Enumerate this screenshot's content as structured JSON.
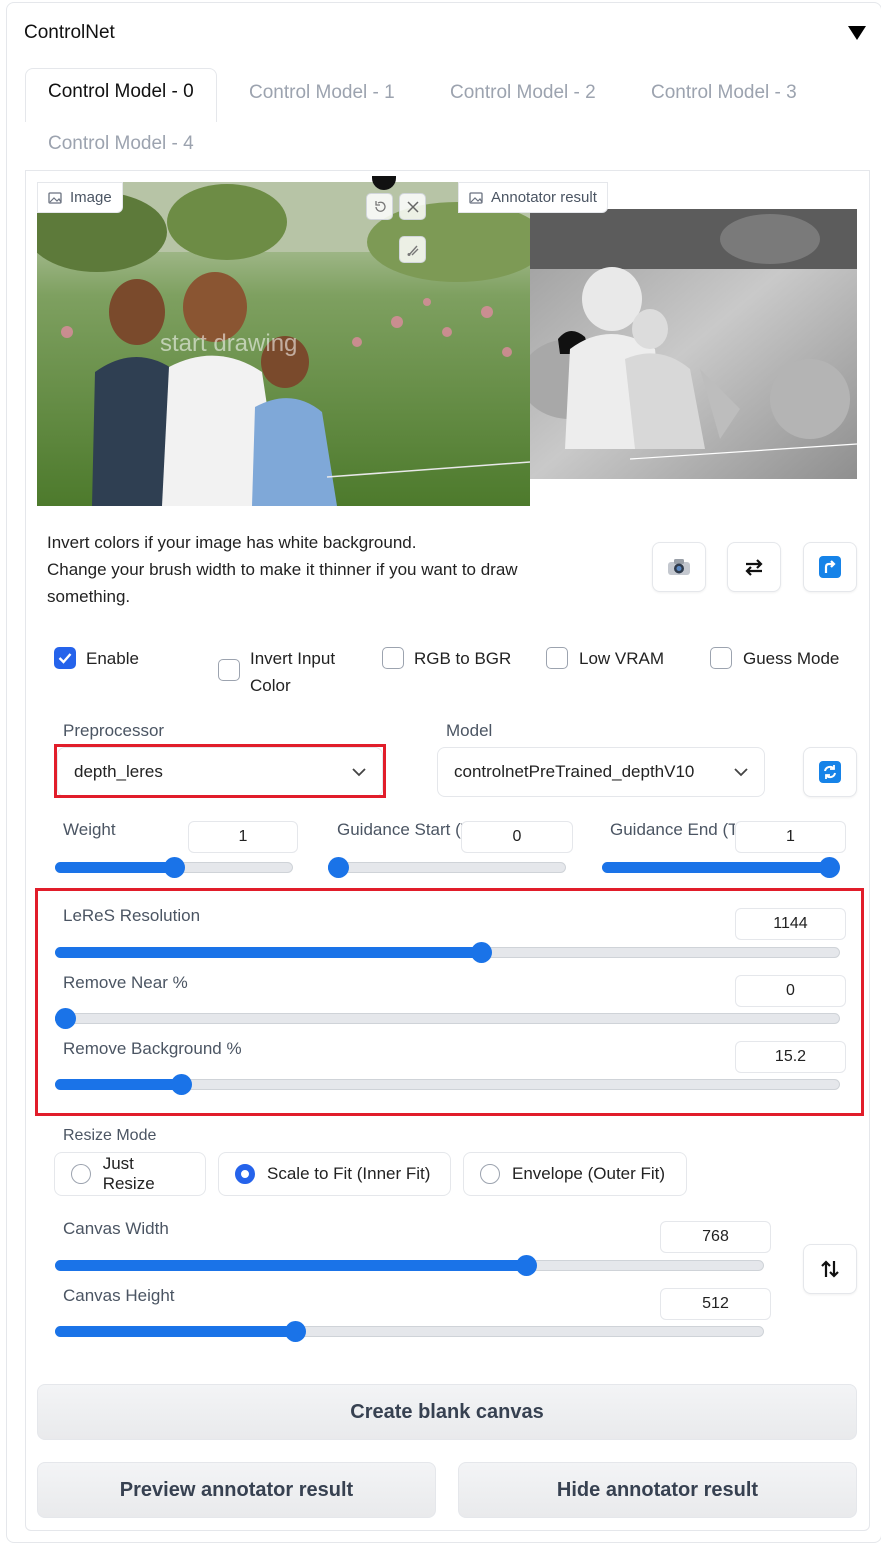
{
  "section": {
    "title": "ControlNet"
  },
  "tabs": [
    "Control Model - 0",
    "Control Model - 1",
    "Control Model - 2",
    "Control Model - 3",
    "Control Model - 4"
  ],
  "image_panel": {
    "label": "Image",
    "overlay_text": "start drawing",
    "icons": [
      "image-icon",
      "undo-icon",
      "close-icon",
      "brush-icon"
    ]
  },
  "annotator_panel": {
    "label": "Annotator result"
  },
  "info_text": [
    "Invert colors if your image has white background.",
    "Change your brush width to make it thinner if you want to draw something."
  ],
  "checkboxes": [
    {
      "label": "Enable",
      "checked": true
    },
    {
      "label": "Invert Input Color",
      "checked": false
    },
    {
      "label": "RGB to BGR",
      "checked": false
    },
    {
      "label": "Low VRAM",
      "checked": false
    },
    {
      "label": "Guess Mode",
      "checked": false
    }
  ],
  "preprocessor": {
    "label": "Preprocessor",
    "value": "depth_leres"
  },
  "model": {
    "label": "Model",
    "value": "controlnetPreTrained_depthV10"
  },
  "weight": {
    "label": "Weight",
    "value": "1",
    "fraction": 0.5
  },
  "guidance_start": {
    "label": "Guidance Start (T",
    "value": "0",
    "fraction": 0.0
  },
  "guidance_end": {
    "label": "Guidance End (T",
    "value": "1",
    "fraction": 1.0
  },
  "leres_resolution": {
    "label": "LeReS Resolution",
    "value": "1144",
    "fraction": 0.545
  },
  "remove_near": {
    "label": "Remove Near %",
    "value": "0",
    "fraction": 0.0
  },
  "remove_background": {
    "label": "Remove Background %",
    "value": "15.2",
    "fraction": 0.152
  },
  "resize_mode": {
    "label": "Resize Mode",
    "options": [
      "Just Resize",
      "Scale to Fit (Inner Fit)",
      "Envelope (Outer Fit)"
    ],
    "selected": 1
  },
  "canvas_width": {
    "label": "Canvas Width",
    "value": "768",
    "fraction": 0.67
  },
  "canvas_height": {
    "label": "Canvas Height",
    "value": "512",
    "fraction": 0.335
  },
  "buttons": {
    "create": "Create blank canvas",
    "preview": "Preview annotator result",
    "hide": "Hide annotator result"
  },
  "colors": {
    "accent": "#1a73e8",
    "highlight": "#e11d2a"
  }
}
